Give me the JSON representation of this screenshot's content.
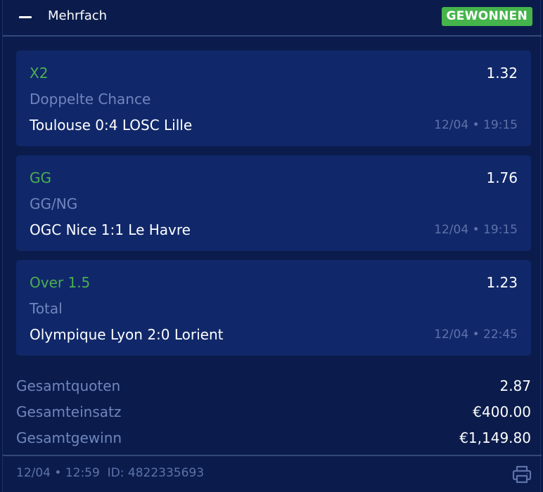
{
  "header": {
    "title": "Mehrfach",
    "status": "GEWONNEN",
    "status_color": "#45b44b",
    "collapse_icon": "minus-icon"
  },
  "bets": [
    {
      "selection": "X2",
      "odds": "1.32",
      "market": "Doppelte Chance",
      "event": "Toulouse 0:4 LOSC Lille",
      "time": "12/04 • 19:15"
    },
    {
      "selection": "GG",
      "odds": "1.76",
      "market": "GG/NG",
      "event": "OGC Nice 1:1 Le Havre",
      "time": "12/04 • 19:15"
    },
    {
      "selection": "Over 1.5",
      "odds": "1.23",
      "market": "Total",
      "event": "Olympique Lyon 2:0 Lorient",
      "time": "12/04 • 22:45"
    }
  ],
  "summary": {
    "total_odds_label": "Gesamtquoten",
    "total_odds_value": "2.87",
    "total_stake_label": "Gesamteinsatz",
    "total_stake_value": "€400.00",
    "total_win_label": "Gesamtgewinn",
    "total_win_value": "€1,149.80"
  },
  "footer": {
    "datetime": "12/04 • 12:59",
    "id_text": "ID: 4822335693",
    "print_icon": "printer-icon"
  },
  "colors": {
    "background": "#0b1c4c",
    "card": "#10286a",
    "selection_green": "#4caf50",
    "muted_text": "#6f86bd"
  }
}
